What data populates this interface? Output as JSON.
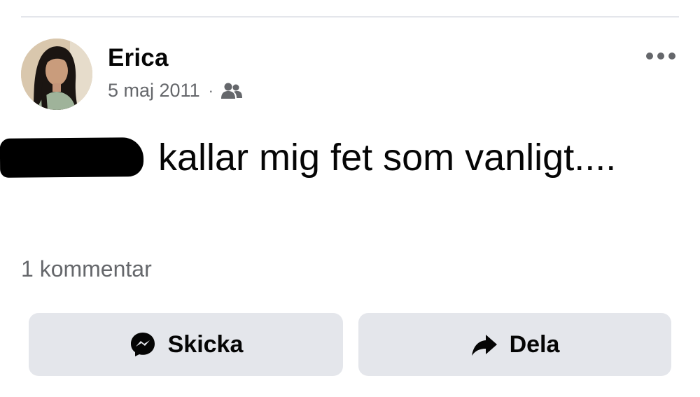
{
  "post": {
    "author": "Erica",
    "date": "5 maj 2011",
    "separator": "·",
    "audience_icon": "friends-icon",
    "text_after_redaction": " kallar mig fet som vanligt....",
    "comment_count": "1 kommentar"
  },
  "actions": {
    "send_label": "Skicka",
    "send_icon": "messenger-icon",
    "share_label": "Dela",
    "share_icon": "share-arrow-icon"
  },
  "colors": {
    "button_bg": "#e4e6eb",
    "secondary_text": "#65676b",
    "primary_text": "#050505"
  }
}
